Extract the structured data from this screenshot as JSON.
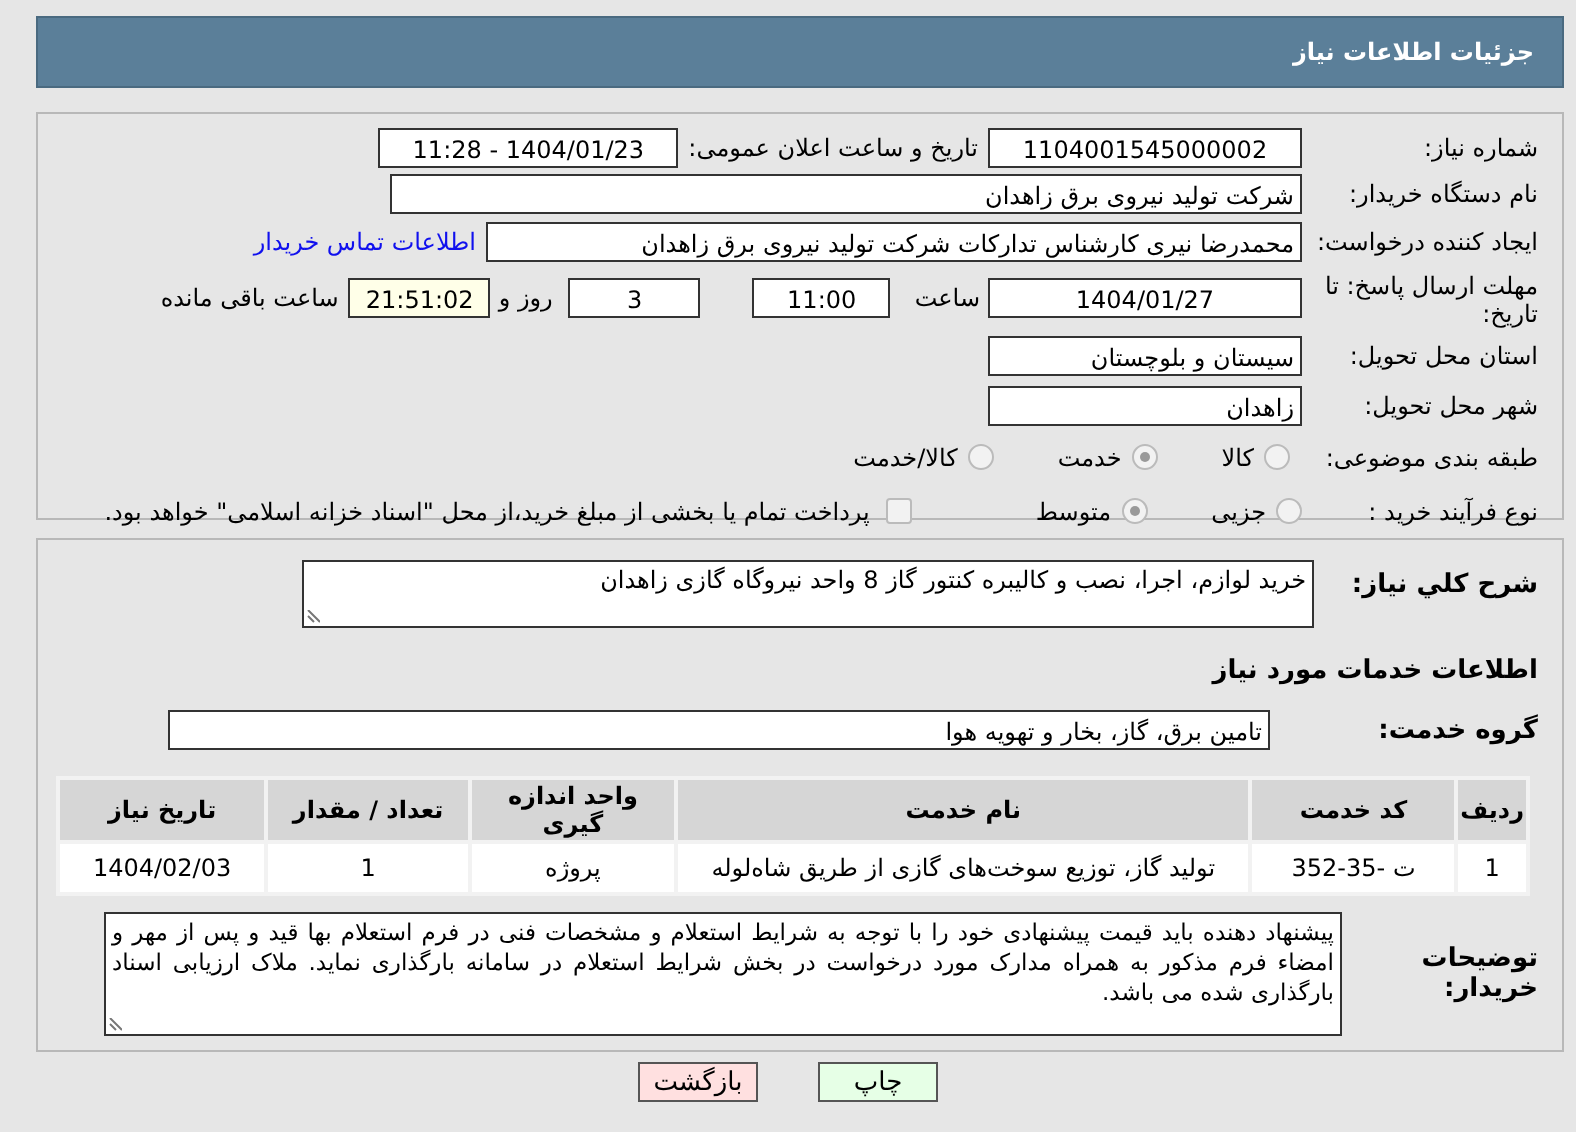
{
  "header": {
    "title": "جزئیات اطلاعات نیاز"
  },
  "need_number": {
    "label": "شماره نیاز:",
    "value": "1104001545000002"
  },
  "announce": {
    "label": "تاریخ و ساعت اعلان عمومی:",
    "value": "1404/01/23 - 11:28"
  },
  "buyer": {
    "label": "نام دستگاه خریدار:",
    "value": "شرکت تولید نیروی برق زاهدان"
  },
  "creator": {
    "label": "ایجاد کننده درخواست:",
    "value": "محمدرضا نیری کارشناس تدارکات شرکت تولید نیروی برق زاهدان",
    "link": "اطلاعات تماس خریدار"
  },
  "deadline": {
    "label": "مهلت ارسال پاسخ: تا تاریخ:",
    "date": "1404/01/27",
    "time_label": "ساعت",
    "time": "11:00",
    "days": "3",
    "days_label": "روز و",
    "remaining": "21:51:02",
    "remaining_label": "ساعت باقی مانده"
  },
  "province": {
    "label": "استان محل تحویل:",
    "value": "سیستان و بلوچستان"
  },
  "city": {
    "label": "شهر محل تحویل:",
    "value": "زاهدان"
  },
  "category": {
    "label": "طبقه بندی موضوعی:",
    "options": [
      {
        "label": "کالا",
        "selected": false
      },
      {
        "label": "خدمت",
        "selected": true
      },
      {
        "label": "کالا/خدمت",
        "selected": false
      }
    ]
  },
  "process": {
    "label": "نوع فرآیند خرید :",
    "options": [
      {
        "label": "جزیی",
        "selected": false
      },
      {
        "label": "متوسط",
        "selected": true
      }
    ],
    "payment": {
      "label": "پرداخت تمام یا بخشی از مبلغ خرید،از محل \"اسناد خزانه اسلامی\" خواهد بود.",
      "checked": false
    }
  },
  "description": {
    "label": "شرح کلي نياز:",
    "value": "خرید لوازم، اجرا، نصب و کالیبره کنتور گاز 8 واحد نیروگاه گازی زاهدان"
  },
  "services_heading": "اطلاعات خدمات مورد نیاز",
  "service_group": {
    "label": "گروه خدمت:",
    "value": "تامین برق، گاز، بخار و تهویه هوا"
  },
  "table": {
    "columns": [
      "ردیف",
      "کد خدمت",
      "نام خدمت",
      "واحد اندازه گیری",
      "تعداد / مقدار",
      "تاریخ نیاز"
    ],
    "rows": [
      [
        "1",
        "ت -35-352",
        "تولید گاز، توزیع سوخت‌های گازی از طریق شاه‌لوله",
        "پروژه",
        "1",
        "1404/02/03"
      ]
    ]
  },
  "notes": {
    "label": "توضیحات خریدار:",
    "value": "پیشنهاد دهنده باید قیمت پیشنهادی خود را با توجه به شرایط استعلام و مشخصات فنی در فرم استعلام بها قید و پس از مهر و امضاء فرم مذکور به همراه مدارک مورد درخواست در بخش شرایط استعلام در سامانه بارگذاری نماید. ملاک ارزیابی اسناد بارگذاری شده می باشد."
  },
  "buttons": [
    {
      "label": "چاپ",
      "kind": "print"
    },
    {
      "label": "بازگشت",
      "kind": "back"
    }
  ]
}
